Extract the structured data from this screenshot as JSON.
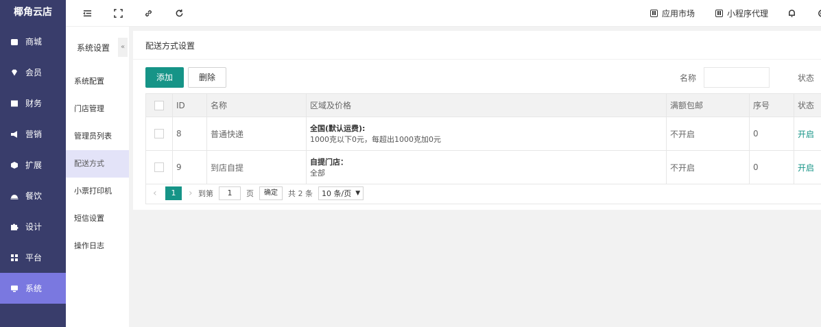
{
  "app": {
    "title": "椰角云店"
  },
  "sidebar": {
    "items": [
      {
        "label": "商城",
        "icon": "shop-icon"
      },
      {
        "label": "会员",
        "icon": "diamond-icon"
      },
      {
        "label": "财务",
        "icon": "wallet-icon"
      },
      {
        "label": "营销",
        "icon": "megaphone-icon"
      },
      {
        "label": "扩展",
        "icon": "cube-icon"
      },
      {
        "label": "餐饮",
        "icon": "dish-icon"
      },
      {
        "label": "设计",
        "icon": "puzzle-icon"
      },
      {
        "label": "平台",
        "icon": "grid-icon"
      },
      {
        "label": "系统",
        "icon": "monitor-icon",
        "active": true
      }
    ]
  },
  "topbar": {
    "app_market": "应用市场",
    "mini_agent": "小程序代理"
  },
  "subnav": {
    "title": "系统设置",
    "collapse": "«",
    "items": [
      {
        "label": "系统配置"
      },
      {
        "label": "门店管理"
      },
      {
        "label": "管理员列表"
      },
      {
        "label": "配送方式",
        "active": true
      },
      {
        "label": "小票打印机"
      },
      {
        "label": "短信设置"
      },
      {
        "label": "操作日志"
      }
    ]
  },
  "main": {
    "title": "配送方式设置",
    "add_label": "添加",
    "delete_label": "删除",
    "filter_name_label": "名称",
    "filter_status_label": "状态",
    "filter_name_value": "",
    "table": {
      "headers": [
        "ID",
        "名称",
        "区域及价格",
        "满额包邮",
        "序号",
        "状态"
      ],
      "rows": [
        {
          "id": "8",
          "name": "普通快递",
          "region_title": "全国(默认运费):",
          "region_detail": "1000克以下0元，每超出1000克加0元",
          "free_ship": "不开启",
          "order": "0",
          "status": "开启"
        },
        {
          "id": "9",
          "name": "到店自提",
          "region_title": "自提门店：",
          "region_detail": "全部",
          "free_ship": "不开启",
          "order": "0",
          "status": "开启"
        }
      ]
    },
    "pager": {
      "prev": "‹",
      "next": "›",
      "current_page": "1",
      "goto_label": "到第",
      "goto_value": "1",
      "page_unit": "页",
      "confirm_label": "确定",
      "total_text": "共 2 条",
      "page_size": "10 条/页"
    }
  },
  "colors": {
    "sidebar_bg": "#393d6b",
    "sidebar_active": "#7a78e0",
    "primary": "#169487"
  }
}
